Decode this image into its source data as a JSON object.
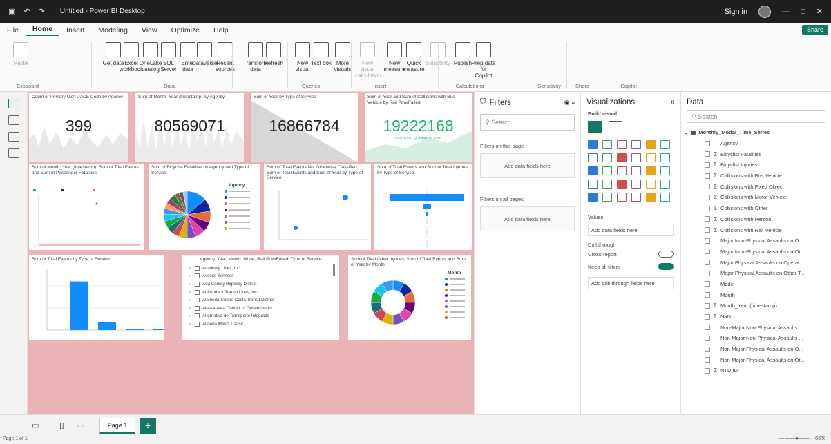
{
  "window": {
    "title": "Untitled - Power BI Desktop",
    "signin": "Sign in"
  },
  "menu": {
    "items": [
      "File",
      "Home",
      "Insert",
      "Modeling",
      "View",
      "Optimize",
      "Help"
    ],
    "share": "Share"
  },
  "ribbon": {
    "buttons": [
      {
        "label": "Paste",
        "dim": true
      },
      {
        "label": "Get data",
        "dim": false
      },
      {
        "label": "Excel workbook",
        "dim": false
      },
      {
        "label": "OneLake catalog",
        "dim": false
      },
      {
        "label": "SQL Server",
        "dim": false
      },
      {
        "label": "Enter data",
        "dim": false
      },
      {
        "label": "Dataverse",
        "dim": false
      },
      {
        "label": "Recent sources",
        "dim": false
      },
      {
        "label": "Transform data",
        "dim": false
      },
      {
        "label": "Refresh",
        "dim": false
      },
      {
        "label": "New visual",
        "dim": false
      },
      {
        "label": "Text box",
        "dim": false
      },
      {
        "label": "More visuals",
        "dim": false
      },
      {
        "label": "New visual calculation",
        "dim": true
      },
      {
        "label": "New measure",
        "dim": false
      },
      {
        "label": "Quick measure",
        "dim": false
      },
      {
        "label": "Sensitivity",
        "dim": true
      },
      {
        "label": "Publish",
        "dim": false
      },
      {
        "label": "Prep data for Copilot",
        "dim": false
      }
    ],
    "groups": [
      "Clipboard",
      "Data",
      "Queries",
      "Insert",
      "Calculations",
      "Sensitivity",
      "Share",
      "Copilot"
    ]
  },
  "cards": [
    {
      "title": "Count of Primary UZA UACE Code by Agency",
      "value": "399"
    },
    {
      "title": "Sum of Month_Year (timestamp) by Agency",
      "value": "80569071"
    },
    {
      "title": "Sum of Year by Type of Service",
      "value": "16866784"
    },
    {
      "title": "Sum of Year and Sum of Collisions with Bus Vehicle by Rail Pow/Failed",
      "value": "19222168",
      "sub": "Goal: 67111 (+28488750.33%)"
    }
  ],
  "visuals": {
    "v5": "Sum of Month_Year (timestamp), Sum of Total Events and Sum of Passenger Fatalities",
    "v6": "Sum of Bicyclist Fatalities by Agency and Type of Service",
    "v6legend": "Agency",
    "v7": "Sum of Total Events Not Otherwise Classified, Sum of Total Events and Sum of Year by Type of Service",
    "v8": "Sum of Total Events and Sum of Total Injuries by Type of Service",
    "v9": "Sum of Total Events by Type of Service",
    "v10": "Agency, Year, Month, Mode, Rail Pow/Failed, Type of Service",
    "v11": "Sum of Total Other Injuries, Sum of Total Events and Sum of Year by Month",
    "v11legend": "Month"
  },
  "chart_data": [
    {
      "type": "bar",
      "title": "Sum of Total Events by Type of Service",
      "values": [
        2.4,
        0.4,
        0.02,
        0.02
      ]
    },
    {
      "type": "scatter",
      "title": "Sum of Total Events Not Otherwise Classified, Sum of Total Events and Sum of Year by Type of Service"
    }
  ],
  "slicer": {
    "items": [
      "Academy Lines, Inc.",
      "Access Services",
      "Ada County Highway District",
      "Adirondack Transit Lines, Inc.",
      "Alameda-Contra Costa Transit District",
      "Alaska Area Council of Governments",
      "Alternativa de Transporte Integrado",
      "Altoona Metro Transit"
    ]
  },
  "filters": {
    "title": "Filters",
    "search": "Search",
    "page_section": "Filters on this page",
    "all_section": "Filters on all pages",
    "add": "Add data fields here"
  },
  "viz": {
    "title": "Visualizations",
    "build": "Build visual",
    "values": "Values",
    "values_well": "Add data fields here",
    "drill": "Drill through",
    "cross": "Cross-report",
    "cross_state": "Off",
    "keep": "Keep all filters",
    "keep_state": "On",
    "drill_well": "Add drill-through fields here",
    "colors": [
      "#2b7cd3",
      "#3a9e5b",
      "#d24c4c",
      "#7c5fbf",
      "#e8a317",
      "#2aa3a3"
    ]
  },
  "data": {
    "title": "Data",
    "search": "Search",
    "table": "Monthly_Modal_Time_Series",
    "fields": [
      {
        "n": "Agency",
        "s": false
      },
      {
        "n": "Bicyclist Fatalities",
        "s": true
      },
      {
        "n": "Bicyclist Injuries",
        "s": true
      },
      {
        "n": "Collisions with Bus Vehicle",
        "s": true
      },
      {
        "n": "Collisions with Fixed Object",
        "s": true
      },
      {
        "n": "Collisions with Motor Vehicle",
        "s": true
      },
      {
        "n": "Collisions with Other",
        "s": true
      },
      {
        "n": "Collisions with Person",
        "s": true
      },
      {
        "n": "Collisions with Rail Vehicle",
        "s": true
      },
      {
        "n": "Major Non-Physical Assaults on O...",
        "s": false
      },
      {
        "n": "Major Non-Physical Assaults on Ot...",
        "s": false
      },
      {
        "n": "Major Physical Assaults on Operat...",
        "s": false
      },
      {
        "n": "Major Physical Assaults on Other T...",
        "s": false
      },
      {
        "n": "Mode",
        "s": false
      },
      {
        "n": "Month",
        "s": false
      },
      {
        "n": "Month_Year (timestamp)",
        "s": true
      },
      {
        "n": "NaN",
        "s": true
      },
      {
        "n": "Non-Major Non-Physical Assaults ...",
        "s": false
      },
      {
        "n": "Non-Major Non-Physical Assaults ...",
        "s": false
      },
      {
        "n": "Non-Major Physical Assaults on O...",
        "s": false
      },
      {
        "n": "Non-Major Physical Assaults on Ot...",
        "s": false
      },
      {
        "n": "NTD ID",
        "s": true
      }
    ]
  },
  "bottom": {
    "page": "Page 1",
    "status": "Page 1 of 1",
    "zoom": "66%"
  }
}
